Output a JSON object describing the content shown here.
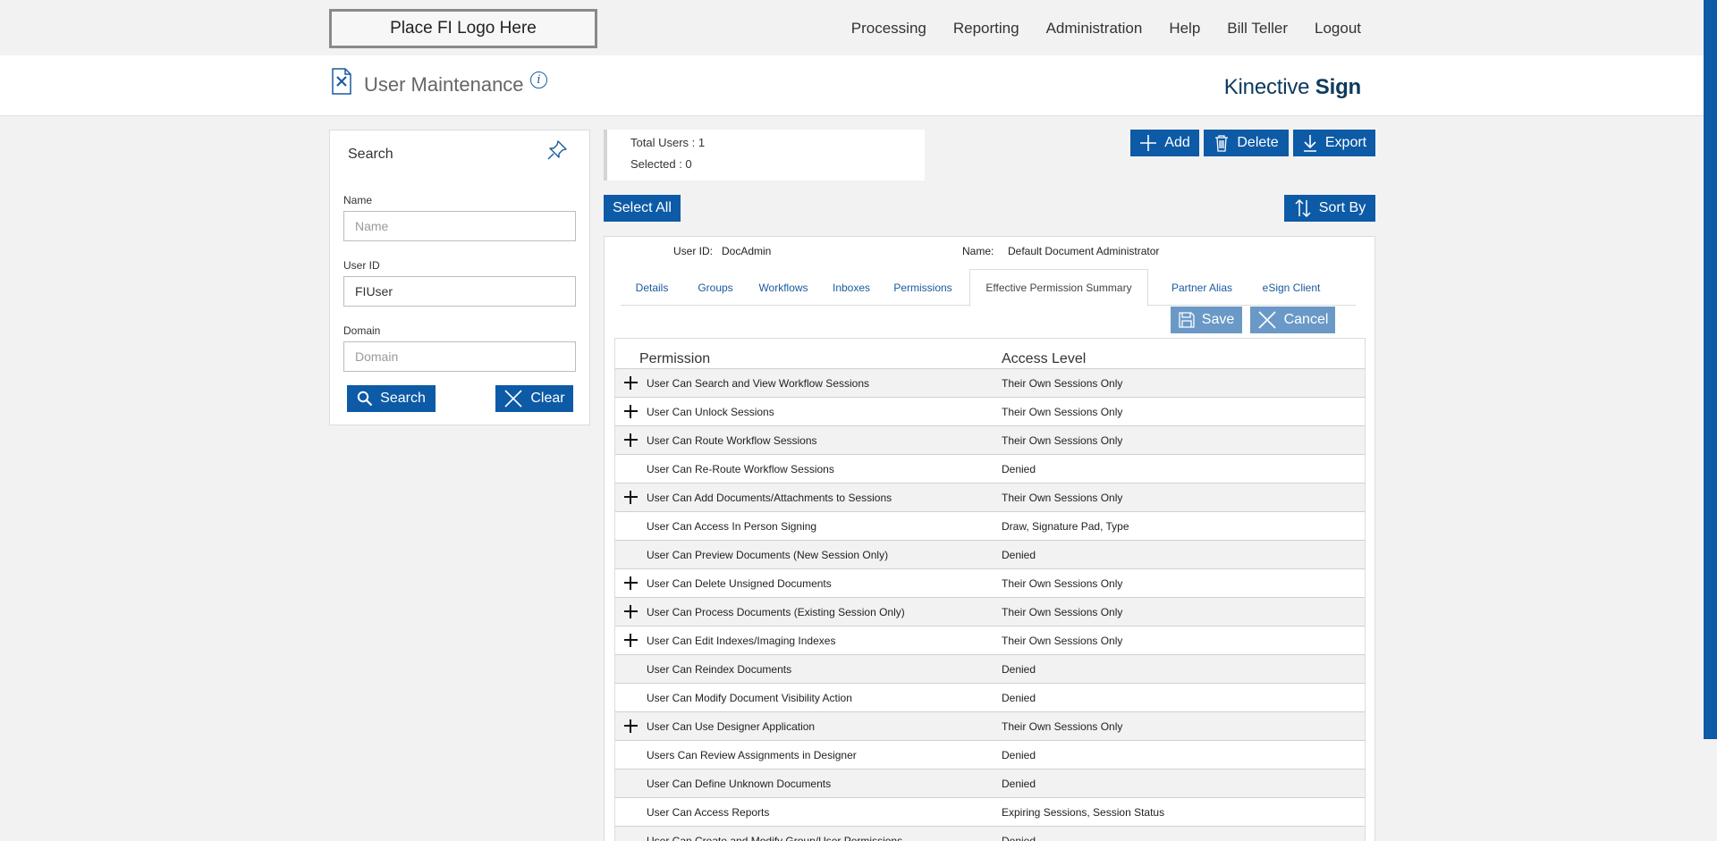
{
  "top": {
    "logo_text": "Place FI Logo Here",
    "nav": [
      "Processing",
      "Reporting",
      "Administration",
      "Help",
      "Bill Teller",
      "Logout"
    ]
  },
  "header": {
    "title": "User Maintenance",
    "info_glyph": "i",
    "brand_light": "Kinective",
    "brand_bold": "Sign"
  },
  "search": {
    "title": "Search",
    "name_label": "Name",
    "name_placeholder": "Name",
    "name_value": "",
    "userid_label": "User ID",
    "userid_value": "FIUser",
    "domain_label": "Domain",
    "domain_placeholder": "Domain",
    "domain_value": "",
    "search_button": "Search",
    "clear_button": "Clear"
  },
  "stats": {
    "total_users": "Total Users : 1",
    "selected": "Selected : 0"
  },
  "actions": {
    "add": "Add",
    "delete": "Delete",
    "export": "Export",
    "select_all": "Select All",
    "sort_by": "Sort By"
  },
  "user": {
    "id_label": "User ID:",
    "id_value": "DocAdmin",
    "name_label": "Name:",
    "name_value": "Default Document Administrator"
  },
  "tabs": [
    "Details",
    "Groups",
    "Workflows",
    "Inboxes",
    "Permissions",
    "Effective Permission Summary",
    "Partner Alias",
    "eSign Client"
  ],
  "active_tab": "Effective Permission Summary",
  "form_buttons": {
    "save": "Save",
    "cancel": "Cancel"
  },
  "permissions": {
    "col_permission": "Permission",
    "col_access": "Access Level",
    "rows": [
      {
        "name": "User Can Search and View Workflow Sessions",
        "level": "Their Own Sessions Only",
        "expandable": true
      },
      {
        "name": "User Can Unlock Sessions",
        "level": "Their Own Sessions Only",
        "expandable": true
      },
      {
        "name": "User Can Route Workflow Sessions",
        "level": "Their Own Sessions Only",
        "expandable": true
      },
      {
        "name": "User Can Re-Route Workflow Sessions",
        "level": "Denied",
        "expandable": false
      },
      {
        "name": "User Can Add Documents/Attachments to Sessions",
        "level": "Their Own Sessions Only",
        "expandable": true
      },
      {
        "name": "User Can Access In Person Signing",
        "level": "Draw, Signature Pad, Type",
        "expandable": false
      },
      {
        "name": "User Can Preview Documents (New Session Only)",
        "level": "Denied",
        "expandable": false
      },
      {
        "name": "User Can Delete Unsigned Documents",
        "level": "Their Own Sessions Only",
        "expandable": true
      },
      {
        "name": "User Can Process Documents (Existing Session Only)",
        "level": "Their Own Sessions Only",
        "expandable": true
      },
      {
        "name": "User Can Edit Indexes/Imaging Indexes",
        "level": "Their Own Sessions Only",
        "expandable": true
      },
      {
        "name": "User Can Reindex Documents",
        "level": "Denied",
        "expandable": false
      },
      {
        "name": "User Can Modify Document Visibility Action",
        "level": "Denied",
        "expandable": false
      },
      {
        "name": "User Can Use Designer Application",
        "level": "Their Own Sessions Only",
        "expandable": true
      },
      {
        "name": "Users Can Review Assignments in Designer",
        "level": "Denied",
        "expandable": false
      },
      {
        "name": "User Can Define Unknown Documents",
        "level": "Denied",
        "expandable": false
      },
      {
        "name": "User Can Access Reports",
        "level": "Expiring Sessions, Session Status",
        "expandable": false
      },
      {
        "name": "User Can Create and Modify Group/User Permissions",
        "level": "Denied",
        "expandable": false
      }
    ]
  },
  "colors": {
    "primary": "#0d5aa6",
    "primary_light": "#6a99c8",
    "brand_text": "#0d3a5e"
  }
}
